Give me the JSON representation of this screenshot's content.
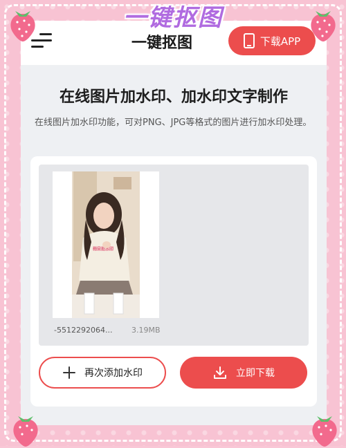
{
  "overlay": {
    "title": "一键抠图"
  },
  "header": {
    "title": "一键抠图",
    "download_app_label": "下载APP"
  },
  "main": {
    "headline": "在线图片加水印、加水印文字制作",
    "subtitle": "在线图片加水印功能，可对PNG、JPG等格式的图片进行加水印处理。"
  },
  "file": {
    "name": "-5512292064...",
    "size": "3.19MB",
    "sweater_text": "梅朵抠水印"
  },
  "actions": {
    "add_again_label": "再次添加水印",
    "download_label": "立即下载"
  },
  "colors": {
    "accent": "#ec4d4d",
    "frame_pink": "#f8c3d3",
    "overlay_purple": "#b06be0"
  },
  "icons": [
    "menu-icon",
    "phone-icon",
    "plus-icon",
    "download-icon",
    "strawberry-icon"
  ]
}
